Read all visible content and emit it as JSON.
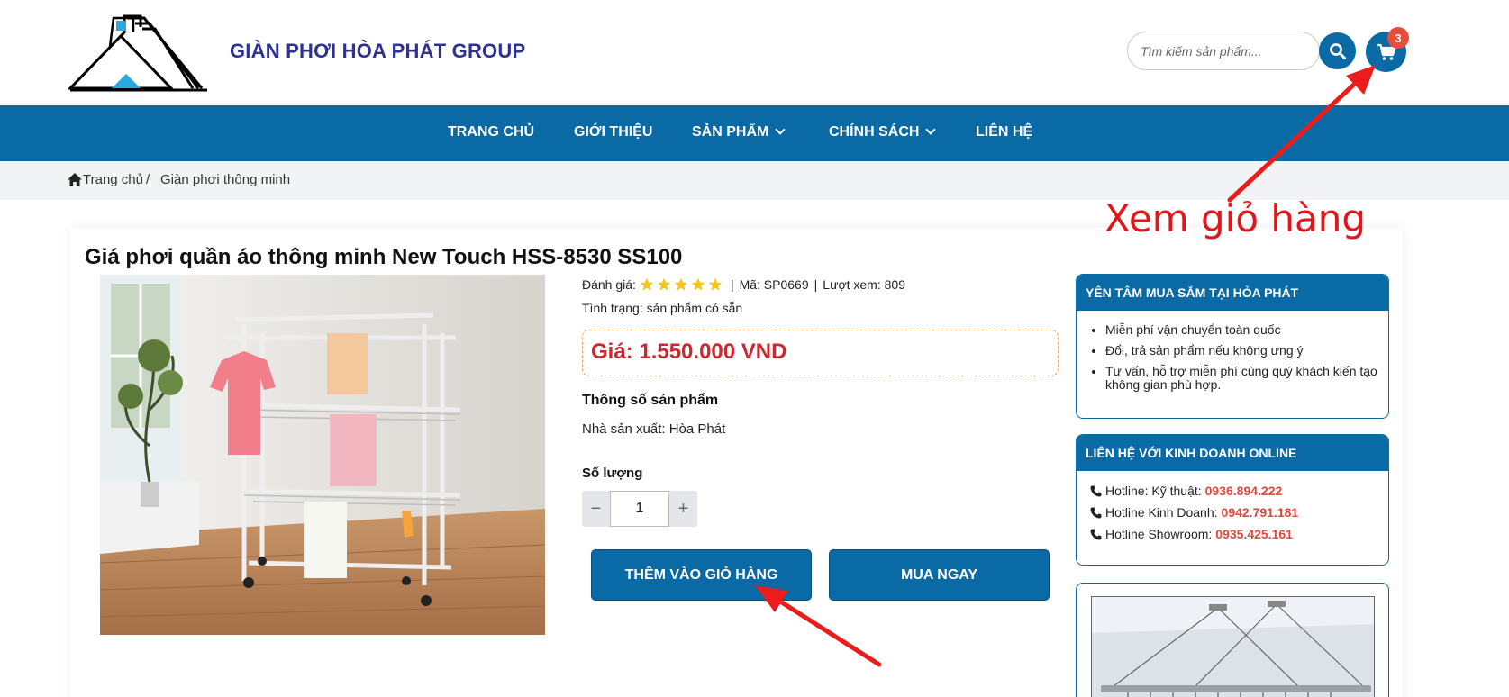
{
  "header": {
    "brand": "GIÀN PHƠI HÒA PHÁT GROUP",
    "search_placeholder": "Tìm kiếm sản phẩm...",
    "cart_count": "3"
  },
  "nav": {
    "items": [
      {
        "label": "TRANG CHỦ",
        "has_dropdown": false
      },
      {
        "label": "GIỚI THIỆU",
        "has_dropdown": false
      },
      {
        "label": "SẢN PHẨM",
        "has_dropdown": true
      },
      {
        "label": "CHÍNH SÁCH",
        "has_dropdown": true
      },
      {
        "label": "LIÊN HỆ",
        "has_dropdown": false
      }
    ]
  },
  "breadcrumb": {
    "home": "Trang chủ",
    "separator": "/",
    "current": "Giàn phơi thông minh"
  },
  "product": {
    "title": "Giá phơi quần áo thông minh New Touch HSS-8530 SS100",
    "rating_label": "Đánh giá:",
    "rating_stars": 5,
    "sep": "|",
    "code": "Mã: SP0669",
    "views": "Lượt xem: 809",
    "status": "Tình trạng: sản phẩm có sẵn",
    "price": "Giá: 1.550.000 VND",
    "spec_title": "Thông số sản phẩm",
    "manufacturer": "Nhà sản xuất: Hòa Phát",
    "qty_label": "Số lượng",
    "qty_value": "1",
    "qty_minus": "−",
    "qty_plus": "+",
    "add_to_cart": "THÊM VÀO GIỎ HÀNG",
    "buy_now": "MUA NGAY"
  },
  "sidebar": {
    "box1": {
      "title": "YÊN TÂM MUA SẮM TẠI HÒA PHÁT",
      "items": [
        "Miễn phí vận chuyển toàn quốc",
        "Đổi, trả sản phẩm nếu không ưng ý",
        "Tư vấn, hỗ trợ miễn phí cùng quý khách kiến tạo không gian phù hợp."
      ]
    },
    "box2": {
      "title": "LIÊN HỆ VỚI KINH DOANH ONLINE",
      "hotlines": [
        {
          "label": "Hotline: Kỹ thuật:",
          "number": "0936.894.222"
        },
        {
          "label": "Hotline Kinh Doanh:",
          "number": "0942.791.181"
        },
        {
          "label": "Hotline Showroom:",
          "number": "0935.425.161"
        }
      ]
    }
  },
  "annotation": {
    "text": "Xem giỏ hàng",
    "color": "#e0161b"
  },
  "colors": {
    "primary": "#0a6aa6",
    "brand": "#2e3192",
    "price": "#d0262d",
    "hotline": "#e0463c",
    "badge": "#e84c3d",
    "star": "#f5c518"
  }
}
